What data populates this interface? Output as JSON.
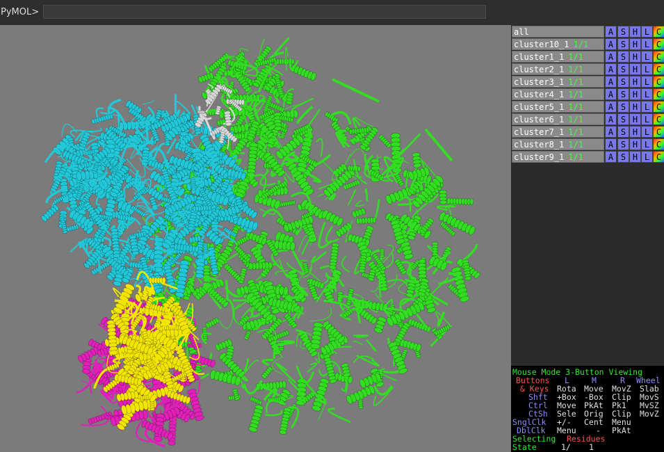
{
  "command": {
    "prompt": "PyMOL>",
    "value": ""
  },
  "objects": [
    {
      "name": "all",
      "state": ""
    },
    {
      "name": "cluster10_1",
      "state": "1/1"
    },
    {
      "name": "cluster1_1",
      "state": "1/1"
    },
    {
      "name": "cluster2_1",
      "state": "1/1"
    },
    {
      "name": "cluster3_1",
      "state": "1/1"
    },
    {
      "name": "cluster4_1",
      "state": "1/1"
    },
    {
      "name": "cluster5_1",
      "state": "1/1"
    },
    {
      "name": "cluster6_1",
      "state": "1/1"
    },
    {
      "name": "cluster7_1",
      "state": "1/1"
    },
    {
      "name": "cluster8_1",
      "state": "1/1"
    },
    {
      "name": "cluster9_1",
      "state": "1/1"
    }
  ],
  "object_buttons": [
    "A",
    "S",
    "H",
    "L",
    "C"
  ],
  "mouse": {
    "title": "Mouse Mode 3-Button Viewing",
    "buttons_label": "Buttons",
    "button_cols": [
      "L",
      "M",
      "R",
      "Wheel"
    ],
    "keys_label": "& Keys",
    "rows": [
      {
        "mod": "",
        "cols": [
          "Rota",
          "Move",
          "MovZ",
          "Slab"
        ]
      },
      {
        "mod": "Shft",
        "cols": [
          "+Box",
          "-Box",
          "Clip",
          "MovS"
        ]
      },
      {
        "mod": "Ctrl",
        "cols": [
          "Move",
          "PkAt",
          "Pk1",
          "MvSZ"
        ]
      },
      {
        "mod": "CtSh",
        "cols": [
          "Sele",
          "Orig",
          "Clip",
          "MovZ"
        ]
      }
    ],
    "sngl_label": "SnglClk",
    "sngl_cols": [
      "+/-",
      "Cent",
      "Menu"
    ],
    "dbl_label": "DblClk",
    "dbl_cols": [
      "Menu",
      "-",
      "PkAt"
    ],
    "selecting_label": "Selecting",
    "selecting_value": "Residues",
    "state_label": "State",
    "state_value": "1/",
    "state_total": "1"
  },
  "colors": {
    "viewport_bg": "#7b7b7b",
    "cluster_green": "#33dd22",
    "cluster_cyan": "#22c8d8",
    "cluster_yellow": "#f2e600",
    "cluster_magenta": "#e020b8",
    "cluster_white": "#d8d8d8"
  }
}
